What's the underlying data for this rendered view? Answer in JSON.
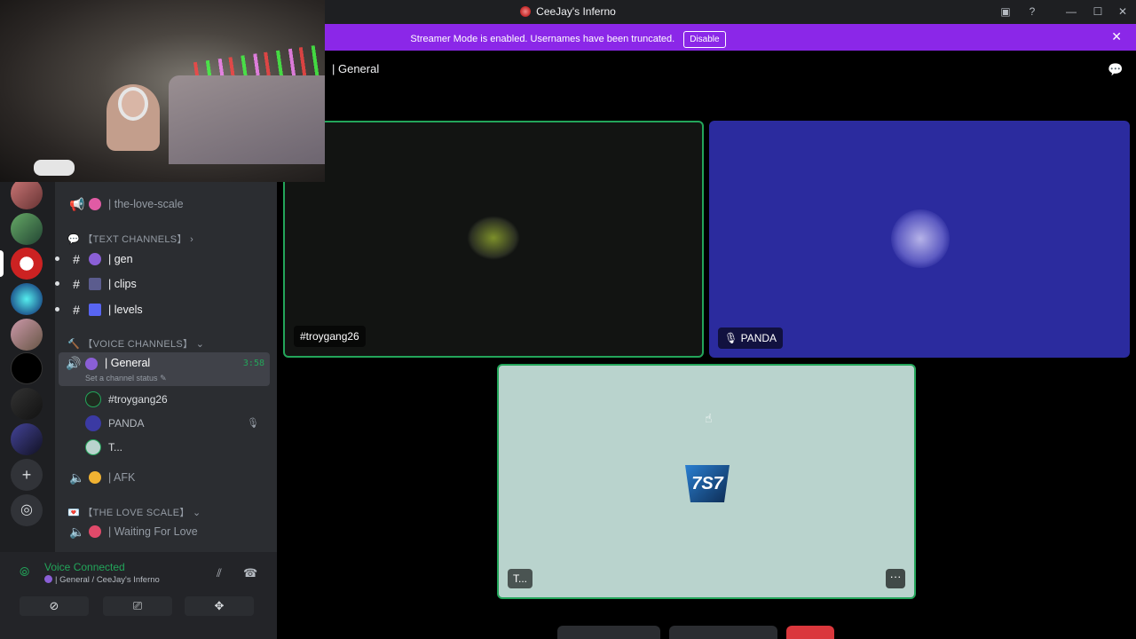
{
  "window": {
    "title": "CeeJay's Inferno",
    "buttons": [
      "inbox-icon",
      "help-icon",
      "minimize-icon",
      "maximize-icon",
      "close-icon"
    ]
  },
  "banner": {
    "message": "Streamer Mode is enabled. Usernames have been truncated.",
    "disable_label": "Disable",
    "color": "#8b27e8"
  },
  "sidebar": {
    "channels_top": [
      {
        "label": "| the-love-scale",
        "type": "announcement"
      }
    ],
    "text_category": "【TEXT CHANNELS】",
    "text_channels": [
      {
        "label": "| gen"
      },
      {
        "label": "| clips"
      },
      {
        "label": "| levels"
      }
    ],
    "voice_category": "【VOICE CHANNELS】",
    "active_voice": {
      "label": "| General",
      "timer": "3:58",
      "status": "Set a channel status"
    },
    "voice_users": [
      {
        "name": "#troygang26"
      },
      {
        "name": "PANDA"
      },
      {
        "name": "T..."
      }
    ],
    "afk": {
      "label": "| AFK"
    },
    "love_category": "【THE LOVE SCALE】",
    "love_channel": {
      "label": "| Waiting For Love"
    }
  },
  "voice_panel": {
    "title": "Voice Connected",
    "subtitle": "| General / CeeJay's Inferno"
  },
  "main": {
    "channel_title": "| General",
    "tiles": [
      {
        "name": "#troygang26"
      },
      {
        "name": "PANDA"
      },
      {
        "name": "T..."
      }
    ]
  }
}
